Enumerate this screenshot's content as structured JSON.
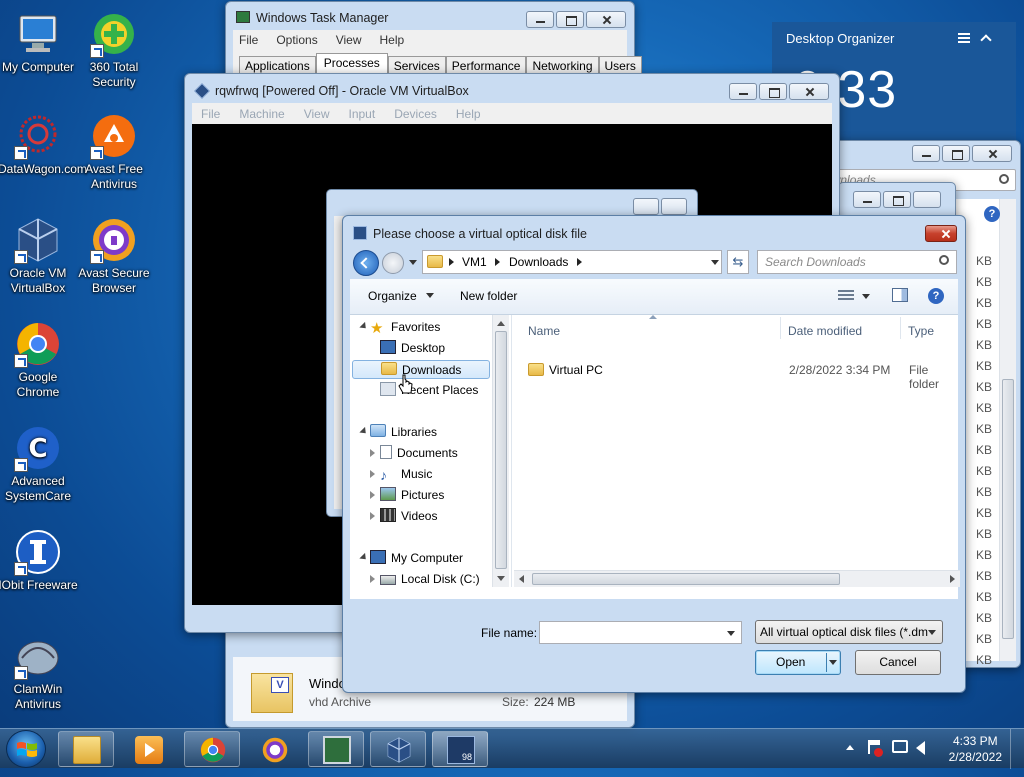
{
  "desktop": {
    "icons": [
      {
        "label": "My Computer"
      },
      {
        "label": "360 Total Security"
      },
      {
        "label": "DataWagon.com"
      },
      {
        "label": "Avast Free Antivirus"
      },
      {
        "label": "Oracle VM VirtualBox"
      },
      {
        "label": "Avast Secure Browser"
      },
      {
        "label": "Google Chrome"
      },
      {
        "label": "Advanced SystemCare"
      },
      {
        "label": "IObit Freeware"
      },
      {
        "label": "ClamWin Antivirus"
      }
    ]
  },
  "organizer": {
    "title": "Desktop Organizer",
    "clock": "6:33"
  },
  "task_manager": {
    "title": "Windows Task Manager",
    "menu": [
      "File",
      "Options",
      "View",
      "Help"
    ],
    "tabs": [
      "Applications",
      "Processes",
      "Services",
      "Performance",
      "Networking",
      "Users"
    ],
    "active_tab": "Processes"
  },
  "virtualbox": {
    "title": "rqwfrwq [Powered Off] - Oracle VM VirtualBox",
    "menu": [
      "File",
      "Machine",
      "View",
      "Input",
      "Devices",
      "Help"
    ]
  },
  "background_explorer": {
    "search_placeholder": "Search Downloads",
    "size_suffix": [
      "KB",
      "KB",
      "KB",
      "KB",
      "KB",
      "KB",
      "KB",
      "KB",
      "KB",
      "KB",
      "KB",
      "KB",
      "KB",
      "KB",
      "KB",
      "KB",
      "KB",
      "KB",
      "KB",
      "KB"
    ]
  },
  "footer_file": {
    "name": "Windo",
    "type": "vhd Archive",
    "size_label": "Size:",
    "size_value": "224 MB"
  },
  "dialog": {
    "title": "Please choose a virtual optical disk file",
    "breadcrumb": [
      "VM1",
      "Downloads"
    ],
    "search_placeholder": "Search Downloads",
    "organize_label": "Organize",
    "new_folder_label": "New folder",
    "nav": {
      "favorites": "Favorites",
      "desktop": "Desktop",
      "downloads": "Downloads",
      "recent": "Recent Places",
      "libraries": "Libraries",
      "documents": "Documents",
      "music": "Music",
      "pictures": "Pictures",
      "videos": "Videos",
      "my_computer": "My Computer",
      "local_disk": "Local Disk (C:)"
    },
    "columns": {
      "name": "Name",
      "date": "Date modified",
      "type": "Type"
    },
    "files": [
      {
        "name": "Virtual PC",
        "date": "2/28/2022 3:34 PM",
        "type": "File folder"
      }
    ],
    "file_name_label": "File name:",
    "file_name_value": "",
    "filter_value": "All virtual optical disk files (*.dm",
    "open_label": "Open",
    "cancel_label": "Cancel"
  },
  "taskbar": {
    "time": "4:33 PM",
    "date": "2/28/2022",
    "buttons": [
      "explorer",
      "media-player",
      "chrome",
      "avast-secure-browser",
      "task-manager",
      "virtualbox",
      "virtual-pc-98"
    ]
  }
}
